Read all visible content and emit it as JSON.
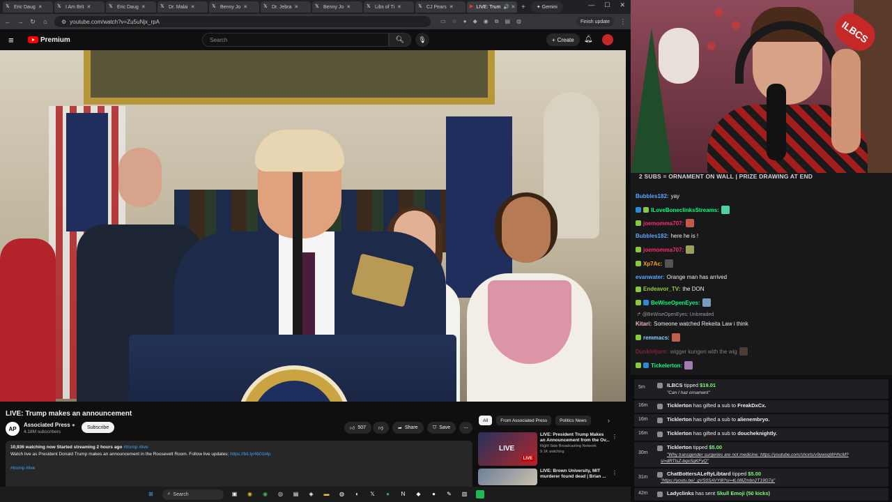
{
  "browser": {
    "tabs": [
      {
        "label": "Eric Daug",
        "active": false
      },
      {
        "label": "I Am Brit",
        "active": false
      },
      {
        "label": "Eric Daug",
        "active": false
      },
      {
        "label": "Dr. Malai",
        "active": false
      },
      {
        "label": "Benny Jo",
        "active": false
      },
      {
        "label": "Dr. Jebra",
        "active": false
      },
      {
        "label": "Benny Jo",
        "active": false
      },
      {
        "label": "Libs of Ti",
        "active": false
      },
      {
        "label": "CJ Pears",
        "active": false
      },
      {
        "label": "LIVE: Trum",
        "active": true
      }
    ],
    "gemini_label": "Gemini",
    "url": "youtube.com/watch?v=Zu5uNjx_rpA",
    "finish_update": "Finish update"
  },
  "youtube": {
    "logo_text": "Premium",
    "search_placeholder": "Search",
    "create_label": "Create",
    "video_title": "LIVE: Trump makes an announcement",
    "channel": {
      "initials": "AP",
      "name": "Associated Press",
      "subs": "4.18M subscribers"
    },
    "subscribe": "Subscribe",
    "like_count": "507",
    "share": "Share",
    "save": "Save",
    "description": {
      "stats": "10,936 watching now  Started streaming 2 hours ago",
      "tags": "#trump #live",
      "text": "Watch live as President Donald Trump makes an announcement in the Roosevelt Room. Follow live updates: ",
      "link": "https://bit.ly/4b01t4p",
      "hashtags": "#trump #live"
    },
    "chips": [
      "All",
      "From Associated Press",
      "Politics News"
    ],
    "recommendations": [
      {
        "title_1": "LIVE: President Trump Makes",
        "title_2": "an Announcement from the Ov...",
        "channel": "Right Side Broadcasting Network",
        "meta": "9.1K watching",
        "badge": "LIVE",
        "thumb_text": "LIVE"
      },
      {
        "title_1": "LIVE: Brown University, MIT",
        "title_2": "murderer found dead | Brian ...",
        "channel": "",
        "meta": "",
        "badge": "",
        "thumb_text": ""
      }
    ]
  },
  "taskbar": {
    "search": "Search"
  },
  "stream": {
    "cam_badge": "ILBCS",
    "banner": "2 SUBS = ORNAMENT ON WALL | PRIZE DRAWING AT END",
    "chat": [
      {
        "user": "Bubbles182:",
        "text": "yay",
        "color": "#5aa9ff"
      },
      {
        "user": "ILoveBoneclinksStreams:",
        "text": "",
        "color": "#00ff7f"
      },
      {
        "user": "joemomma707:",
        "text": "",
        "color": "#ff2a6d"
      },
      {
        "user": "Bubbles182:",
        "text": "here he is !",
        "color": "#5aa9ff"
      },
      {
        "user": "joemomma707:",
        "text": "",
        "color": "#ff2a6d"
      },
      {
        "user": "Xp7Ac:",
        "text": "",
        "color": "#ffa500"
      },
      {
        "user": "evanwater:",
        "text": "Orange man has arrived",
        "color": "#5aa9ff"
      },
      {
        "user": "Endeavor_TV:",
        "text": "the DON",
        "color": "#9acd32"
      },
      {
        "user": "BeWiseOpenEyes:",
        "text": "",
        "color": "#00ff7f"
      },
      {
        "user": "Kitari:",
        "text": "Someone watched Rekeita Law i think",
        "color": "#ffb6c1"
      },
      {
        "user": "remmacs:",
        "text": "",
        "color": "#7fd4ff"
      },
      {
        "user": "Dunkleljorn:",
        "text": "wigger kungen with the wig",
        "color": "#ff2a6d"
      },
      {
        "user": "Tickelerton:",
        "text": "",
        "color": "#00ff7f"
      }
    ],
    "reply_line": "@BeWiseOpenEyes: Unbreaded",
    "events": [
      {
        "time": "5m",
        "name": "ILBCS",
        "action": " tipped ",
        "amount": "$19.01",
        "quote": "\"Can I haz ornament\""
      },
      {
        "time": "16m",
        "name": "Ticklerton",
        "action": " has gifted a sub to ",
        "target": "FreakDxCx."
      },
      {
        "time": "16m",
        "name": "Ticklerton",
        "action": " has gifted a sub to ",
        "target": "alienembryo."
      },
      {
        "time": "16m",
        "name": "Ticklerton",
        "action": " has gifted a sub to ",
        "target": "doucheknightly."
      },
      {
        "time": "30m",
        "name": "Ticklerton",
        "action": " tipped ",
        "amount": "$5.00",
        "quote": "\"Why transgender surgeries are not medicine: https://youtube.com/shorts/v9ywoqWHhcM?",
        "quote2": "si=dRTlsZ-bqxSgKFyQ\""
      },
      {
        "time": "31m",
        "name": "ChatBottersALeftyLibtard",
        "action": " tipped ",
        "amount": "$5.00",
        "quote": "\"https://youtu.be/_gVS0SAVYl8?si=4L0l8Zmbn2T19G7a\""
      },
      {
        "time": "42m",
        "name": "Ladyclinks",
        "action": " has sent ",
        "amount": "Skull Emoji (50 kicks)"
      }
    ]
  }
}
